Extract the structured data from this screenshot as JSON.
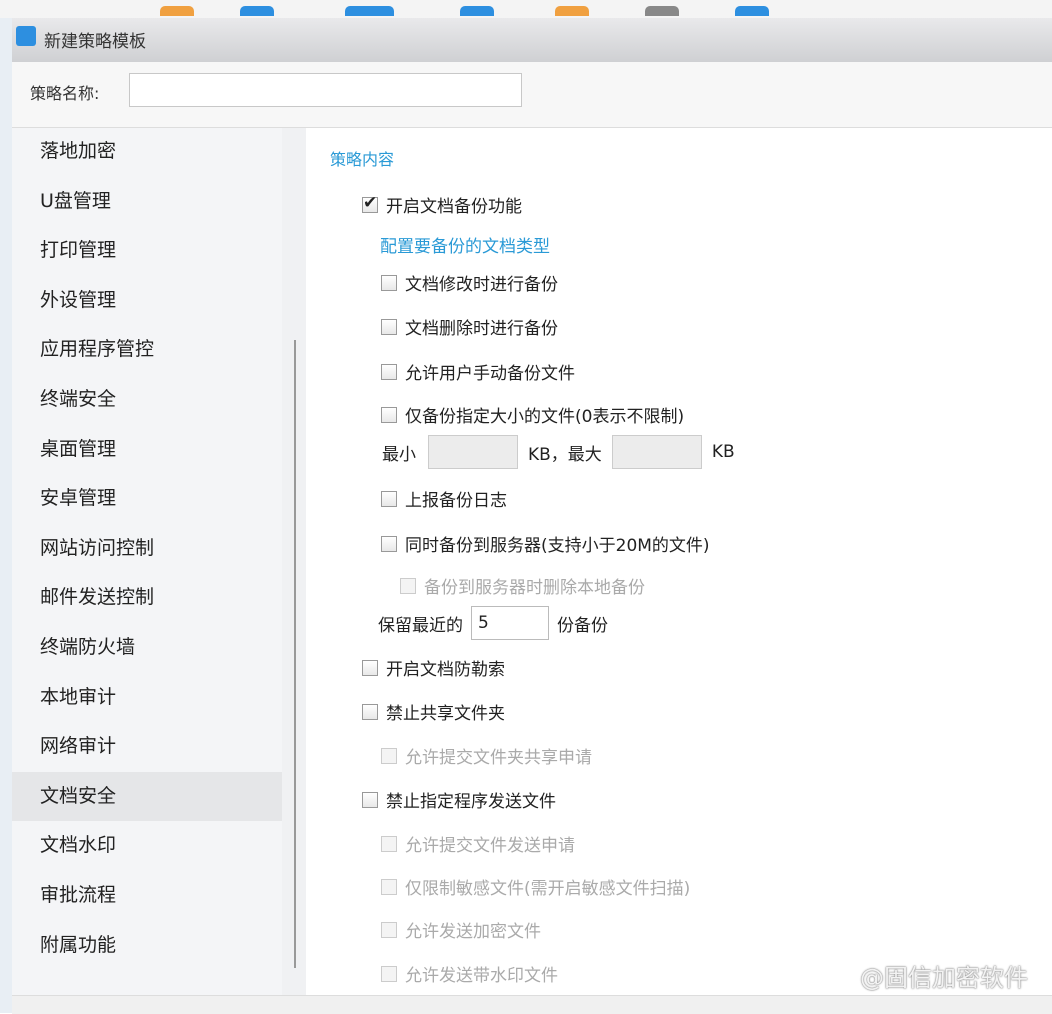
{
  "window": {
    "title": "新建策略模板"
  },
  "name_field": {
    "label": "策略名称:",
    "value": ""
  },
  "sidebar": {
    "items": [
      "落地加密",
      "U盘管理",
      "打印管理",
      "外设管理",
      "应用程序管控",
      "终端安全",
      "桌面管理",
      "安卓管理",
      "网站访问控制",
      "邮件发送控制",
      "终端防火墙",
      "本地审计",
      "网络审计",
      "文档安全",
      "文档水印",
      "审批流程",
      "附属功能"
    ],
    "selected": "文档安全"
  },
  "content": {
    "section_title": "策略内容",
    "enable_backup": {
      "label": "开启文档备份功能",
      "checked": true
    },
    "config_link": "配置要备份的文档类型",
    "backup_on_modify": "文档修改时进行备份",
    "backup_on_delete": "文档删除时进行备份",
    "allow_manual": "允许用户手动备份文件",
    "size_limit": "仅备份指定大小的文件(0表示不限制)",
    "min_label": "最小",
    "kb_max_label": "KB，最大",
    "kb_label": "KB",
    "min_value": "",
    "max_value": "",
    "report_log": "上报备份日志",
    "backup_server": "同时备份到服务器(支持小于20M的文件)",
    "delete_local": "备份到服务器时删除本地备份",
    "keep_prefix": "保留最近的",
    "keep_value": "5",
    "keep_suffix": "份备份",
    "anti_ransom": "开启文档防勒索",
    "forbid_share": "禁止共享文件夹",
    "allow_share_request": "允许提交文件夹共享申请",
    "forbid_send": "禁止指定程序发送文件",
    "allow_send_request": "允许提交文件发送申请",
    "only_sensitive": "仅限制敏感文件(需开启敏感文件扫描)",
    "allow_encrypted": "允许发送加密文件",
    "allow_watermarked": "允许发送带水印文件"
  },
  "watermark": "@固信加密软件"
}
